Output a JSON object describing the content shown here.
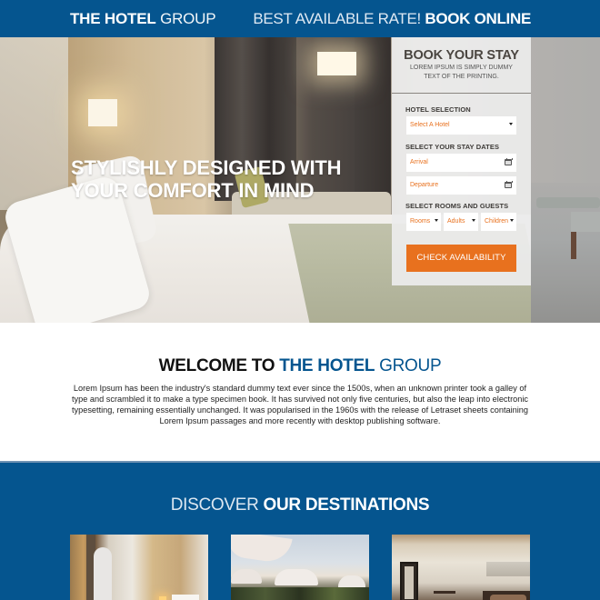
{
  "header": {
    "brand_bold": "THE HOTEL",
    "brand_light": "GROUP",
    "rate_light": "BEST AVAILABLE RATE!",
    "rate_bold": "BOOK ONLINE",
    "bg_color": "#05558f"
  },
  "hero": {
    "title_line1": "STYLISHLY DESIGNED WITH",
    "title_line2": "YOUR COMFORT IN MIND",
    "image": "hotel-bedroom-photo"
  },
  "booking": {
    "title": "BOOK YOUR STAY",
    "subtitle_line1": "LOREM IPSUM IS SIMPLY DUMMY",
    "subtitle_line2": "TEXT OF THE PRINTING.",
    "hotel_label": "HOTEL SELECTION",
    "hotel_select": "Select A Hotel",
    "dates_label": "SELECT YOUR STAY DATES",
    "arrival_placeholder": "Arrival",
    "departure_placeholder": "Departure",
    "rooms_label": "SELECT ROOMS AND GUESTS",
    "rooms_select": "Rooms",
    "adults_select": "Adults",
    "children_select": "Children",
    "submit_label": "CHECK AVAILABILITY",
    "accent_color": "#e8711e"
  },
  "welcome": {
    "title_dark": "WELCOME TO",
    "title_blue_bold": "THE HOTEL",
    "title_blue_light": "GROUP",
    "body": "Lorem Ipsum has been the industry's standard dummy text ever since the 1500s, when an unknown printer took a galley of type and scrambled it to make a type specimen book. It has survived not only five centuries, but also the leap into electronic typesetting, remaining essentially unchanged. It was popularised in the 1960s with the release of Letraset sheets containing Lorem Ipsum passages and more recently with desktop publishing software."
  },
  "destinations": {
    "title_light": "DISCOVER",
    "title_bold": "OUR DESTINATIONS",
    "cards": [
      {
        "image": "hotel-room-door-photo"
      },
      {
        "image": "beach-umbrellas-photo"
      },
      {
        "image": "bedroom-suite-photo"
      }
    ]
  }
}
